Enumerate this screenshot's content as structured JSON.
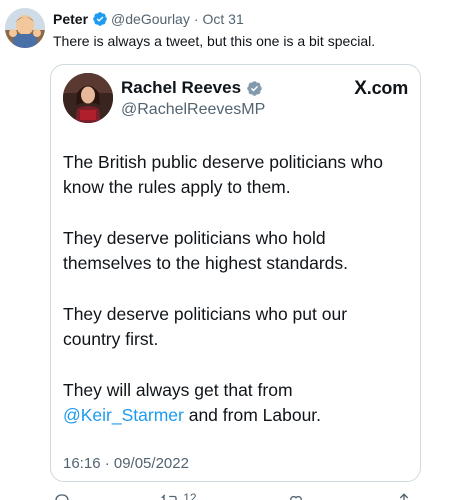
{
  "author": {
    "name": "Peter",
    "handle": "@deGourlay",
    "separator": "·",
    "date": "Oct 31",
    "verified": true
  },
  "tweet": {
    "text": "There is always a tweet, but this one is a bit special."
  },
  "quoted": {
    "name": "Rachel Reeves",
    "handle": "@RachelReevesMP",
    "verified_badge": "grey-verified-icon",
    "source_label": "X.com",
    "paragraphs": [
      [
        "The British public deserve politicians who",
        "know the rules apply to them."
      ],
      [
        "They deserve politicians who hold",
        "themselves to the highest standards."
      ],
      [
        "They deserve politicians who put our",
        "country first."
      ],
      [
        "They will always get that from",
        ""
      ]
    ],
    "mention": "@Keir_Starmer",
    "after_mention": " and from Labour.",
    "timestamp": "16:16 · 09/05/2022"
  },
  "colors": {
    "text": "#0f1419",
    "muted": "#536471",
    "link": "#1d9bf0",
    "border": "#cfd9de",
    "verified_blue": "#1d9bf0",
    "verified_grey": "#829aab"
  },
  "actions": {
    "reply_icon": "reply-icon",
    "retweet_icon": "retweet-icon",
    "retweet_count": "12",
    "like_icon": "heart-icon",
    "share_icon": "share-icon"
  }
}
